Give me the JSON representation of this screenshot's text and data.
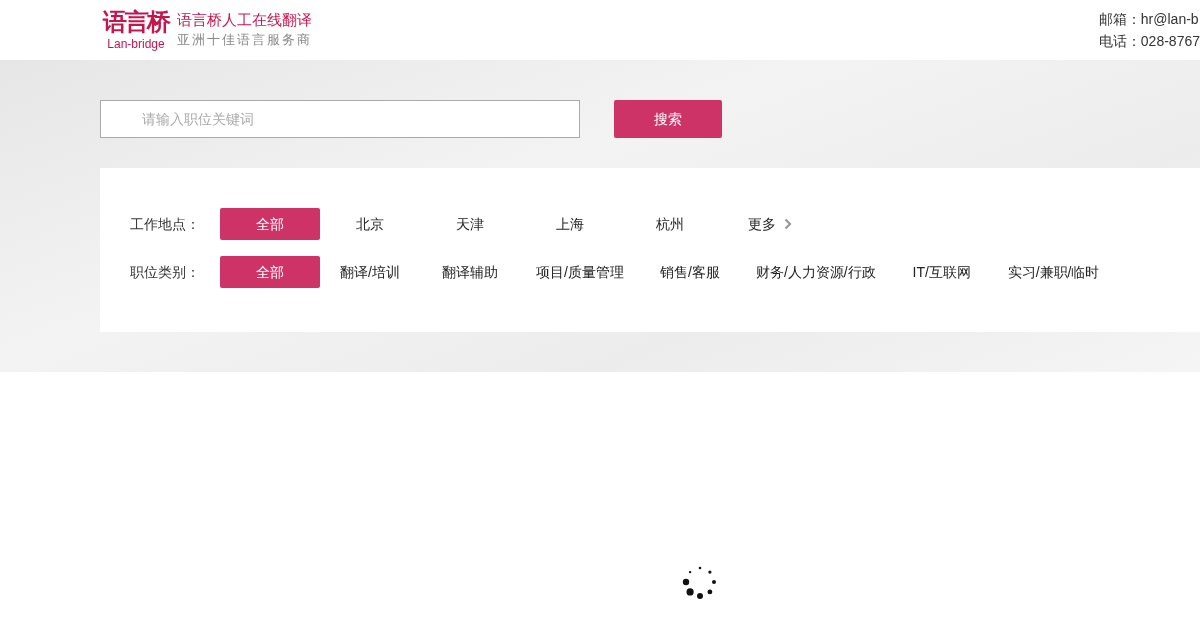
{
  "header": {
    "logo_mark": "语言桥",
    "logo_sub": "Lan-bridge",
    "tagline": "语言桥人工在线翻译",
    "slogan": "亚洲十佳语言服务商",
    "contacts": [
      "邮箱：hr@lan-b",
      "电话：028-8767"
    ]
  },
  "search": {
    "placeholder": "请输入职位关键词",
    "button": "搜索"
  },
  "filters": [
    {
      "label": "工作地点：",
      "options": [
        {
          "text": "全部",
          "selected": true
        },
        {
          "text": "北京",
          "selected": false
        },
        {
          "text": "天津",
          "selected": false
        },
        {
          "text": "上海",
          "selected": false
        },
        {
          "text": "杭州",
          "selected": false
        }
      ],
      "more": "更多"
    },
    {
      "label": "职位类别：",
      "options": [
        {
          "text": "全部",
          "selected": true
        },
        {
          "text": "翻译/培训",
          "selected": false
        },
        {
          "text": "翻译辅助",
          "selected": false
        },
        {
          "text": "项目/质量管理",
          "selected": false
        },
        {
          "text": "销售/客服",
          "selected": false
        },
        {
          "text": "财务/人力资源/行政",
          "selected": false
        },
        {
          "text": "IT/互联网",
          "selected": false
        },
        {
          "text": "实习/兼职/临时",
          "selected": false
        }
      ]
    }
  ],
  "loading": true
}
